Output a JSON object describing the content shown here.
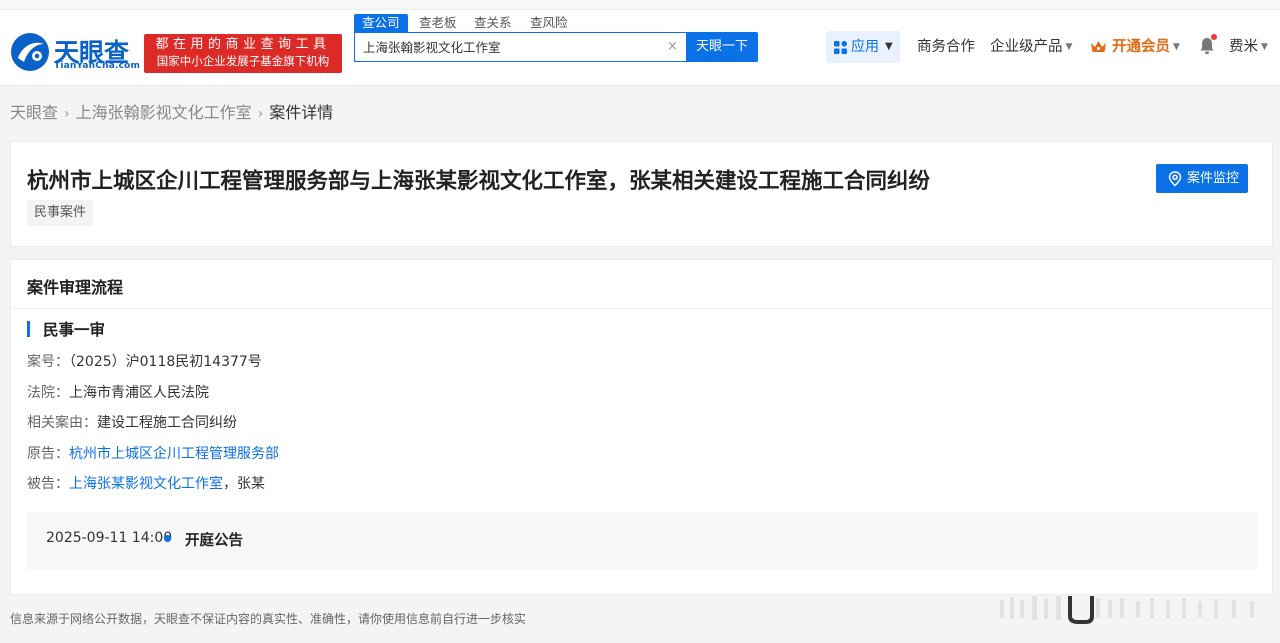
{
  "header": {
    "logo_name": "天眼查",
    "logo_domain": "TianYanCha.com",
    "banner_line1": "都在用的商业查询工具",
    "banner_line2": "国家中小企业发展子基金旗下机构",
    "search_tabs": [
      "查公司",
      "查老板",
      "查关系",
      "查风险"
    ],
    "search_value": "上海张翰影视文化工作室",
    "search_clear": "×",
    "search_button": "天眼一下",
    "nav": {
      "app": "应用",
      "business": "商务合作",
      "enterprise": "企业级产品",
      "vip": "开通会员",
      "user": "费米"
    }
  },
  "breadcrumb": {
    "items": [
      "天眼查",
      "上海张翰影视文化工作室",
      "案件详情"
    ],
    "separator": "›"
  },
  "case": {
    "title": "杭州市上城区企川工程管理服务部与上海张某影视文化工作室，张某相关建设工程施工合同纠纷",
    "tag": "民事案件",
    "monitor_button": "案件监控"
  },
  "process": {
    "section_title": "案件审理流程",
    "stage": "民事一审",
    "rows": {
      "case_no_label": "案号：",
      "case_no": "（2025）沪0118民初14377号",
      "court_label": "法院：",
      "court": "上海市青浦区人民法院",
      "cause_label": "相关案由：",
      "cause": "建设工程施工合同纠纷",
      "plaintiff_label": "原告：",
      "plaintiff": "杭州市上城区企川工程管理服务部",
      "defendant_label": "被告：",
      "defendant_company": "上海张某影视文化工作室",
      "defendant_sep": "，",
      "defendant_person": "张某"
    },
    "timeline": {
      "date": "2025-09-11 14:00",
      "event": "开庭公告"
    }
  },
  "footer_note": "信息来源于网络公开数据，天眼查不保证内容的真实性、准确性，请你使用信息前自行进一步核实",
  "colors": {
    "brand_blue": "#0b71e6",
    "banner_red": "#dc2b27",
    "vip_orange": "#e36a12"
  },
  "icons": {
    "logo": "tianyancha-logo-icon",
    "app": "grid-icon",
    "crown": "crown-icon",
    "bell": "bell-icon",
    "monitor": "location-pin-icon"
  }
}
